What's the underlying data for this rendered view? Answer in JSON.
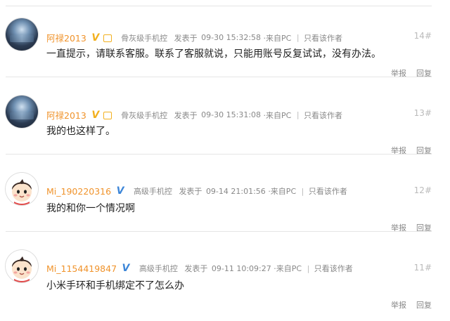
{
  "posts": [
    {
      "username": "阿禄2013",
      "badge": "V",
      "badge_color": "#f2b01e",
      "level": "骨灰级手机控",
      "posted_label": "发表于",
      "datetime": "09-30 15:32:58",
      "source": "·来自PC",
      "only_author": "只看该作者",
      "floor": "14#",
      "content": "一直提示，请联系客服。联系了客服就说，只能用账号反复试试，没有办法。",
      "avatar_icon": "phone-wallpaper-avatar",
      "report": "举报",
      "reply": "回复"
    },
    {
      "username": "阿禄2013",
      "badge": "V",
      "badge_color": "#f2b01e",
      "level": "骨灰级手机控",
      "posted_label": "发表于",
      "datetime": "09-30 15:31:08",
      "source": "·来自PC",
      "only_author": "只看该作者",
      "floor": "13#",
      "content": "我的也这样了。",
      "avatar_icon": "phone-wallpaper-avatar",
      "report": "举报",
      "reply": "回复"
    },
    {
      "username": "Mi_190220316",
      "badge": "V",
      "badge_color": "#3d86d8",
      "level": "高级手机控",
      "posted_label": "发表于",
      "datetime": "09-14 21:01:56",
      "source": "·来自PC",
      "only_author": "只看该作者",
      "floor": "12#",
      "content": "我的和你一个情况啊",
      "avatar_icon": "cartoon-boy-avatar",
      "report": "举报",
      "reply": "回复"
    },
    {
      "username": "Mi_1154419847",
      "badge": "V",
      "badge_color": "#3d86d8",
      "level": "高级手机控",
      "posted_label": "发表于",
      "datetime": "09-11 10:09:27",
      "source": "·来自PC",
      "only_author": "只看该作者",
      "floor": "11#",
      "content": "小米手环和手机绑定不了怎么办",
      "avatar_icon": "cartoon-boy-avatar",
      "report": "举报",
      "reply": "回复"
    }
  ]
}
